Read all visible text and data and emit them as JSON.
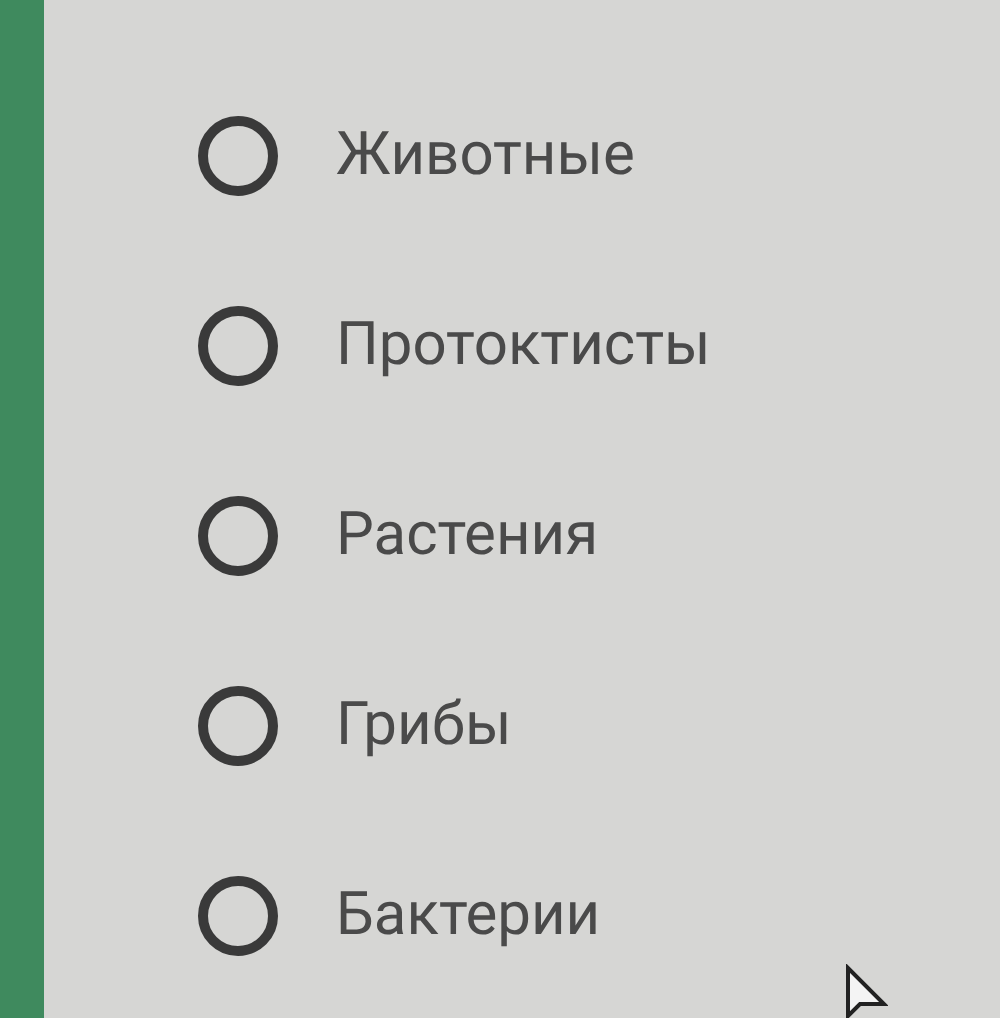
{
  "options": [
    {
      "label": "Животные",
      "selected": false
    },
    {
      "label": "Протоктисты",
      "selected": false
    },
    {
      "label": "Растения",
      "selected": false
    },
    {
      "label": "Грибы",
      "selected": false
    },
    {
      "label": "Бактерии",
      "selected": false
    }
  ]
}
